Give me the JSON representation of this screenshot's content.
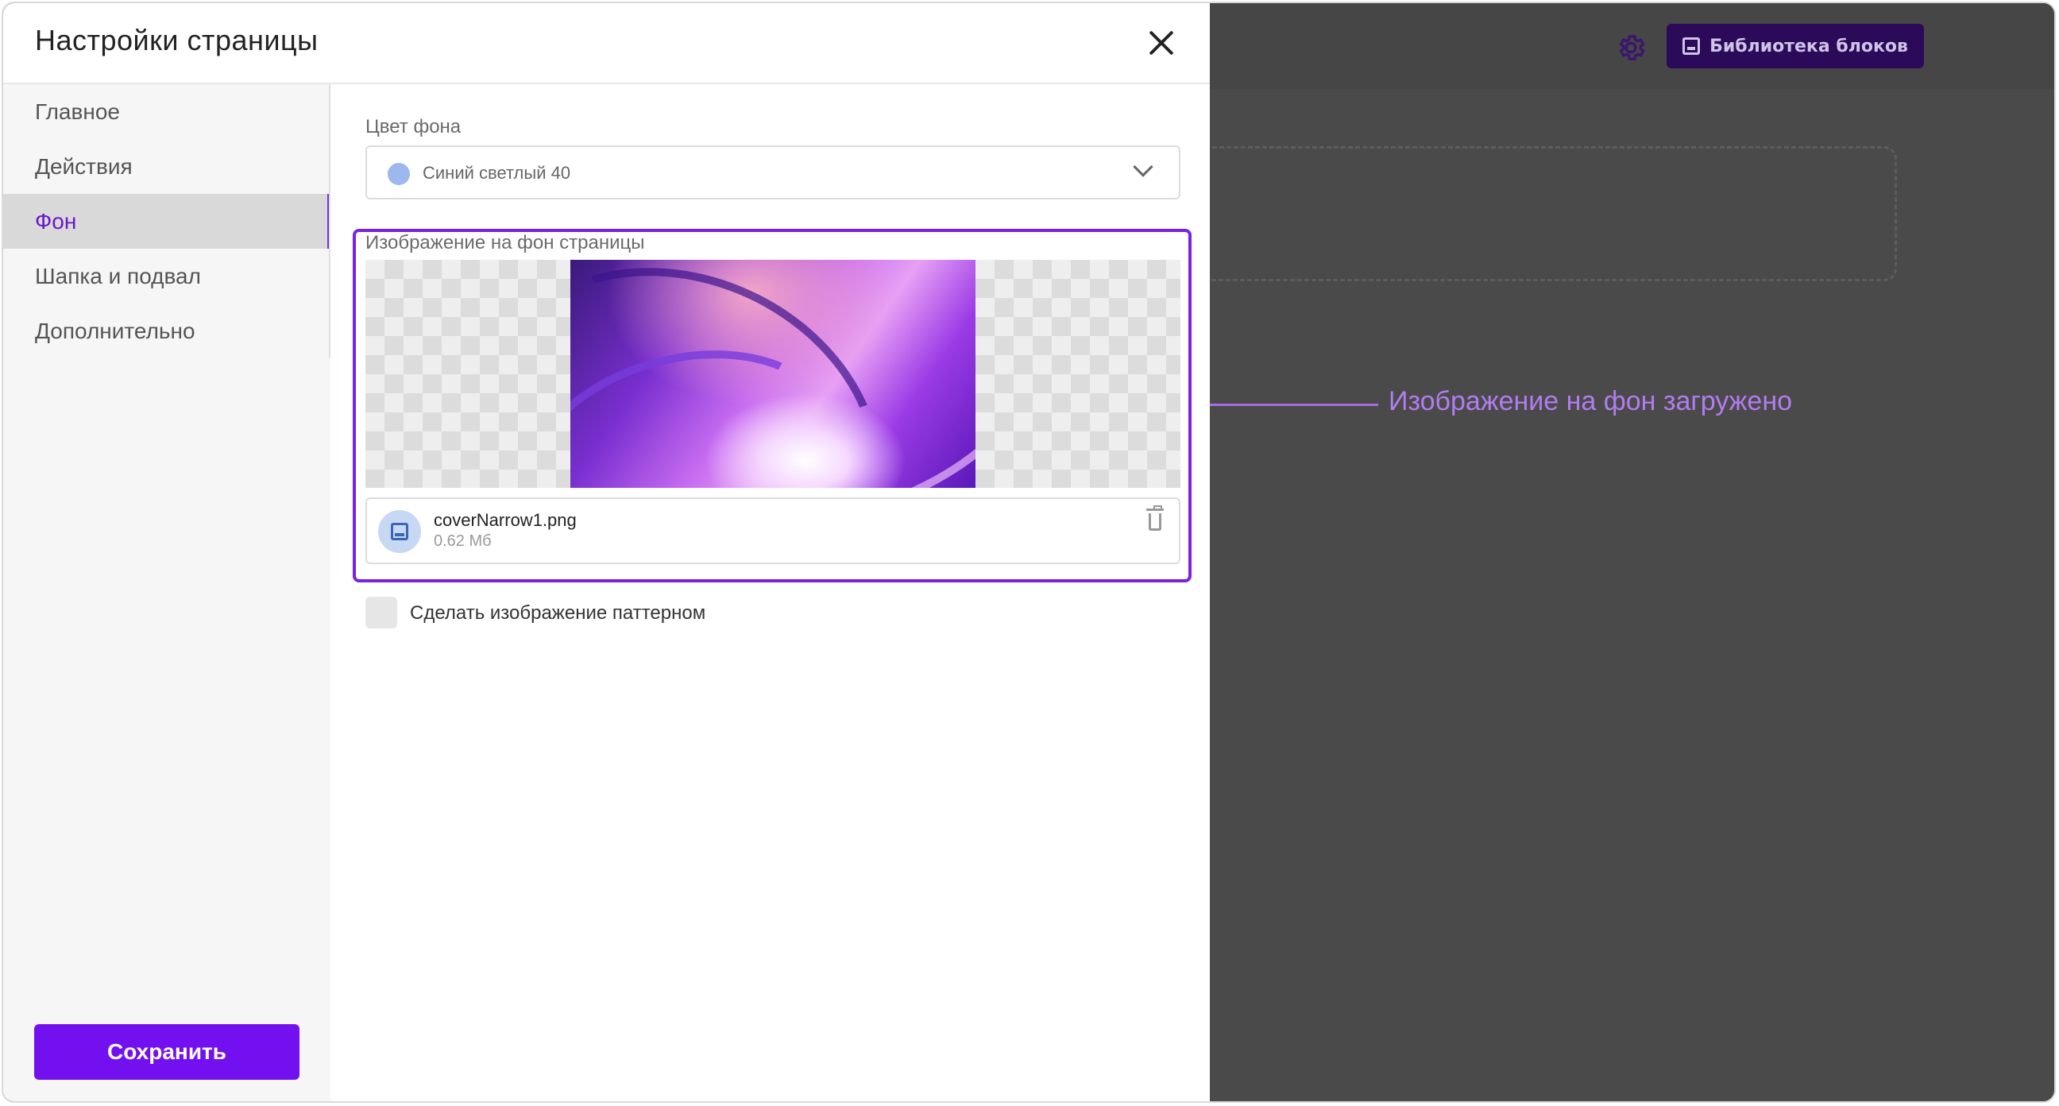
{
  "modal": {
    "title": "Настройки страницы",
    "nav": [
      {
        "label": "Главное",
        "active": false
      },
      {
        "label": "Действия",
        "active": false
      },
      {
        "label": "Фон",
        "active": true
      },
      {
        "label": "Шапка и подвал",
        "active": false
      },
      {
        "label": "Дополнительно",
        "active": false
      }
    ],
    "save_label": "Сохранить"
  },
  "background": {
    "color_label": "Цвет фона",
    "color_value": "Синий светлый 40",
    "color_swatch": "#9db8ec",
    "image_label": "Изображение на фон страницы",
    "file_name": "coverNarrow1.png",
    "file_size": "0.62 Мб",
    "pattern_label": "Сделать изображение паттерном",
    "pattern_checked": false
  },
  "editor": {
    "library_label": "Библиотека блоков"
  },
  "annotation": {
    "text": "Изображение на фон загружено"
  },
  "colors": {
    "accent": "#7210f0",
    "highlight": "#7a22e0",
    "callout": "#b27cf0"
  }
}
